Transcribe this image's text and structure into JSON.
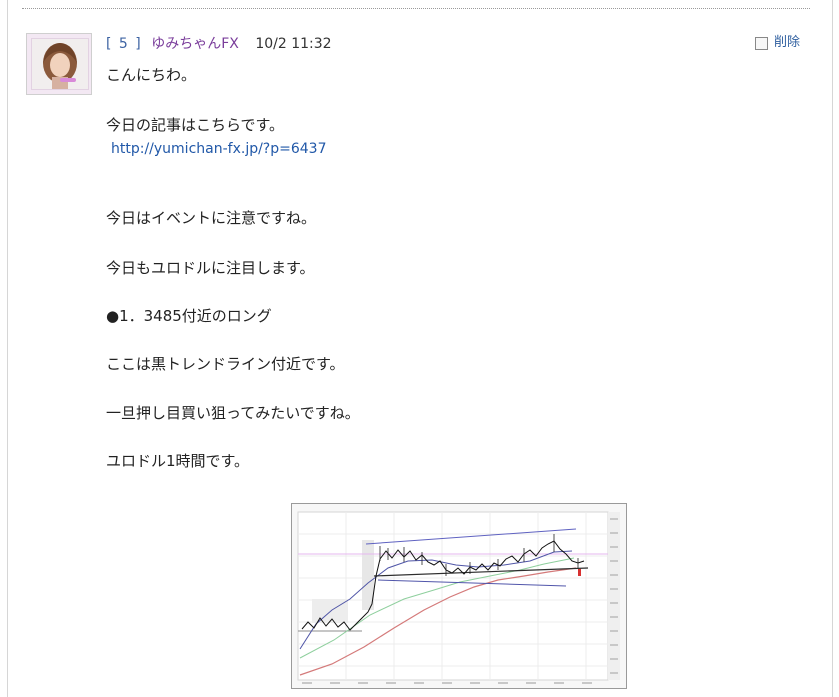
{
  "comment": {
    "number_prefix": "[",
    "number": "5",
    "number_suffix": "]",
    "author": "ゆみちゃんFX",
    "datetime": "10/2 11:32",
    "delete_label": "削除",
    "lines": [
      "こんにちわ。",
      "今日の記事はこちらです。",
      "http://yumichan-fx.jp/?p=6437",
      "今日はイベントに注意ですね。",
      "今日もユロドルに注目します。",
      "●1．3485付近のロング",
      "ここは黒トレンドライン付近です。",
      "一旦押し目買い狙ってみたいですね。",
      "ユロドル1時間です。"
    ]
  },
  "colors": {
    "author": "#7a3d9b",
    "number": "#3d63a3",
    "link": "#2158a8",
    "delete": "#2f5f9f"
  },
  "icons": {
    "delete": "checkbox-icon",
    "attachment": "forex-chart-thumbnail"
  }
}
